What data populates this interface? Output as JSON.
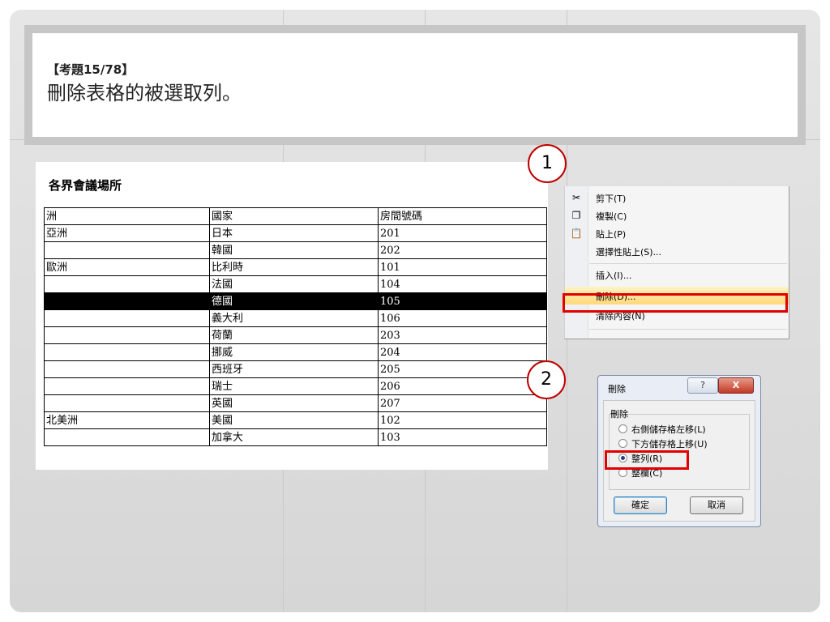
{
  "question": {
    "number": "【考題15/78】",
    "text": "刪除表格的被選取列。"
  },
  "document": {
    "title": "各界會議場所",
    "columns": [
      "洲",
      "國家",
      "房間號碼"
    ],
    "rows": [
      [
        "亞洲",
        "日本",
        "201"
      ],
      [
        "",
        "韓國",
        "202"
      ],
      [
        "歐洲",
        "比利時",
        "101"
      ],
      [
        "",
        "法國",
        "104"
      ],
      [
        "",
        "德國",
        "105"
      ],
      [
        "",
        "義大利",
        "106"
      ],
      [
        "",
        "荷蘭",
        "203"
      ],
      [
        "",
        "挪威",
        "204"
      ],
      [
        "",
        "西班牙",
        "205"
      ],
      [
        "",
        "瑞士",
        "206"
      ],
      [
        "",
        "英國",
        "207"
      ],
      [
        "北美洲",
        "美國",
        "102"
      ],
      [
        "",
        "加拿大",
        "103"
      ]
    ],
    "selected_row_index": 4
  },
  "steps": {
    "step1": "1",
    "step2": "2"
  },
  "context_menu": {
    "items": [
      {
        "label": "剪下(T)",
        "icon": "scissors-icon"
      },
      {
        "label": "複製(C)",
        "icon": "copy-icon"
      },
      {
        "label": "貼上(P)",
        "icon": "paste-icon"
      },
      {
        "label": "選擇性貼上(S)...",
        "icon": ""
      },
      {
        "label": "插入(I)...",
        "icon": ""
      },
      {
        "label": "刪除(D)...",
        "icon": ""
      },
      {
        "label": "清除內容(N)",
        "icon": ""
      }
    ],
    "highlighted": "刪除(D)..."
  },
  "delete_dialog": {
    "title": "刪除",
    "help_label": "?",
    "close_label": "X",
    "group_label": "刪除",
    "options": [
      {
        "label": "右側儲存格左移(L)",
        "checked": false
      },
      {
        "label": "下方儲存格上移(U)",
        "checked": false
      },
      {
        "label": "整列(R)",
        "checked": true
      },
      {
        "label": "整欄(C)",
        "checked": false
      }
    ],
    "ok_label": "確定",
    "cancel_label": "取消"
  },
  "colors": {
    "highlight_border": "#e00000",
    "step_circle": "#c00000"
  }
}
